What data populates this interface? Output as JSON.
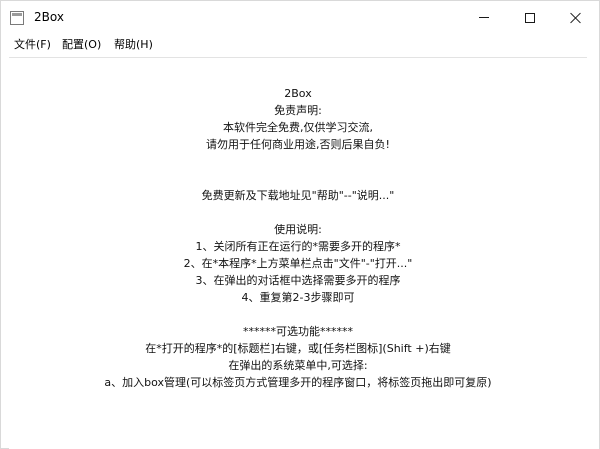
{
  "window": {
    "title": "2Box"
  },
  "menu": {
    "file": "文件(F)",
    "config": "配置(O)",
    "help": "帮助(H)"
  },
  "content": {
    "lines": [
      "2Box",
      "免责声明:",
      "本软件完全免费,仅供学习交流,",
      "请勿用于任何商业用途,否则后果自负!",
      "",
      "",
      "免费更新及下载地址见\"帮助\"--\"说明...\"",
      "",
      "使用说明:",
      "1、关闭所有正在运行的*需要多开的程序*",
      "2、在*本程序*上方菜单栏点击\"文件\"-\"打开...\"",
      "3、在弹出的对话框中选择需要多开的程序",
      "4、重复第2-3步骤即可",
      "",
      "******可选功能******",
      "在*打开的程序*的[标题栏]右键，或[任务栏图标](Shift +)右键",
      "在弹出的系统菜单中,可选择:",
      "a、加入box管理(可以标签页方式管理多开的程序窗口，将标签页拖出即可复原)"
    ]
  }
}
